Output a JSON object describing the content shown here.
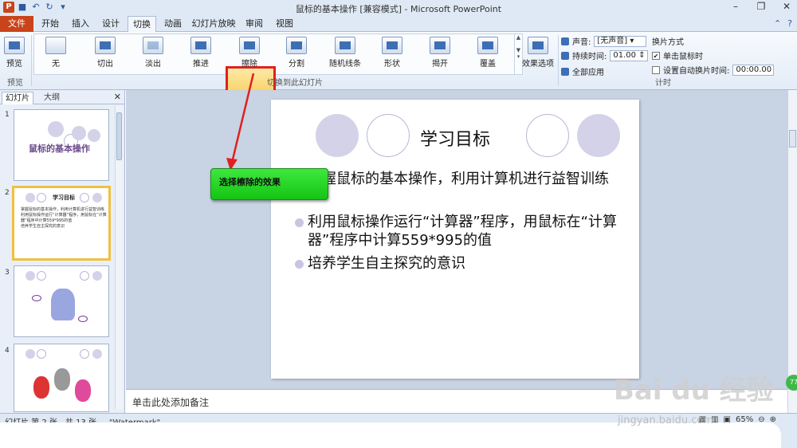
{
  "window": {
    "title": "鼠标的基本操作 [兼容模式] - Microsoft PowerPoint",
    "minimize": "–",
    "restore": "❐",
    "close": "✕"
  },
  "tabs": {
    "file": "文件",
    "items": [
      "开始",
      "插入",
      "设计",
      "切换",
      "动画",
      "幻灯片放映",
      "审阅",
      "视图"
    ],
    "active": "切换"
  },
  "ribbon": {
    "preview": {
      "label": "预览",
      "group": "预览"
    },
    "transitions": [
      "无",
      "切出",
      "淡出",
      "推进",
      "擦除",
      "分割",
      "随机线条",
      "形状",
      "揭开",
      "覆盖"
    ],
    "selected_transition": "擦除",
    "effect_options": "效果选项",
    "group_label": "切换到此幻灯片",
    "timing": {
      "sound_label": "声音:",
      "sound_value": "[无声音]",
      "duration_label": "持续时间:",
      "duration_value": "01.00",
      "apply_all": "全部应用",
      "advance_label": "换片方式",
      "on_click": "单击鼠标时",
      "auto_after": "设置自动换片时间:",
      "auto_value": "00:00.00",
      "group": "计时"
    }
  },
  "panel": {
    "tab_slides": "幻灯片",
    "tab_outline": "大纲",
    "close": "✕",
    "slides": [
      {
        "num": "1",
        "title": "鼠标的基本操作"
      },
      {
        "num": "2",
        "title": "学习目标"
      },
      {
        "num": "3"
      },
      {
        "num": "4"
      }
    ]
  },
  "slide": {
    "title": "学习目标",
    "bullets": [
      "掌握鼠标的基本操作，利用计算机进行益智训练",
      "利用鼠标操作运行“计算器”程序，用鼠标在“计算器”程序中计算559*995的值",
      "培养学生自主探究的意识"
    ]
  },
  "notes": {
    "placeholder": "单击此处添加备注"
  },
  "status": {
    "left": "幻灯片 第 2 张，共 13 张",
    "theme": "\"Watermark\"",
    "zoom": "65%"
  },
  "annotation": {
    "text": "选择檫除的效果"
  },
  "watermark": {
    "brand": "Bai du 经验",
    "sub": "jingyan.baidu.com"
  },
  "colors": {
    "accent": "#c9441a",
    "highlight": "#e02020",
    "callout": "#22cc22"
  }
}
